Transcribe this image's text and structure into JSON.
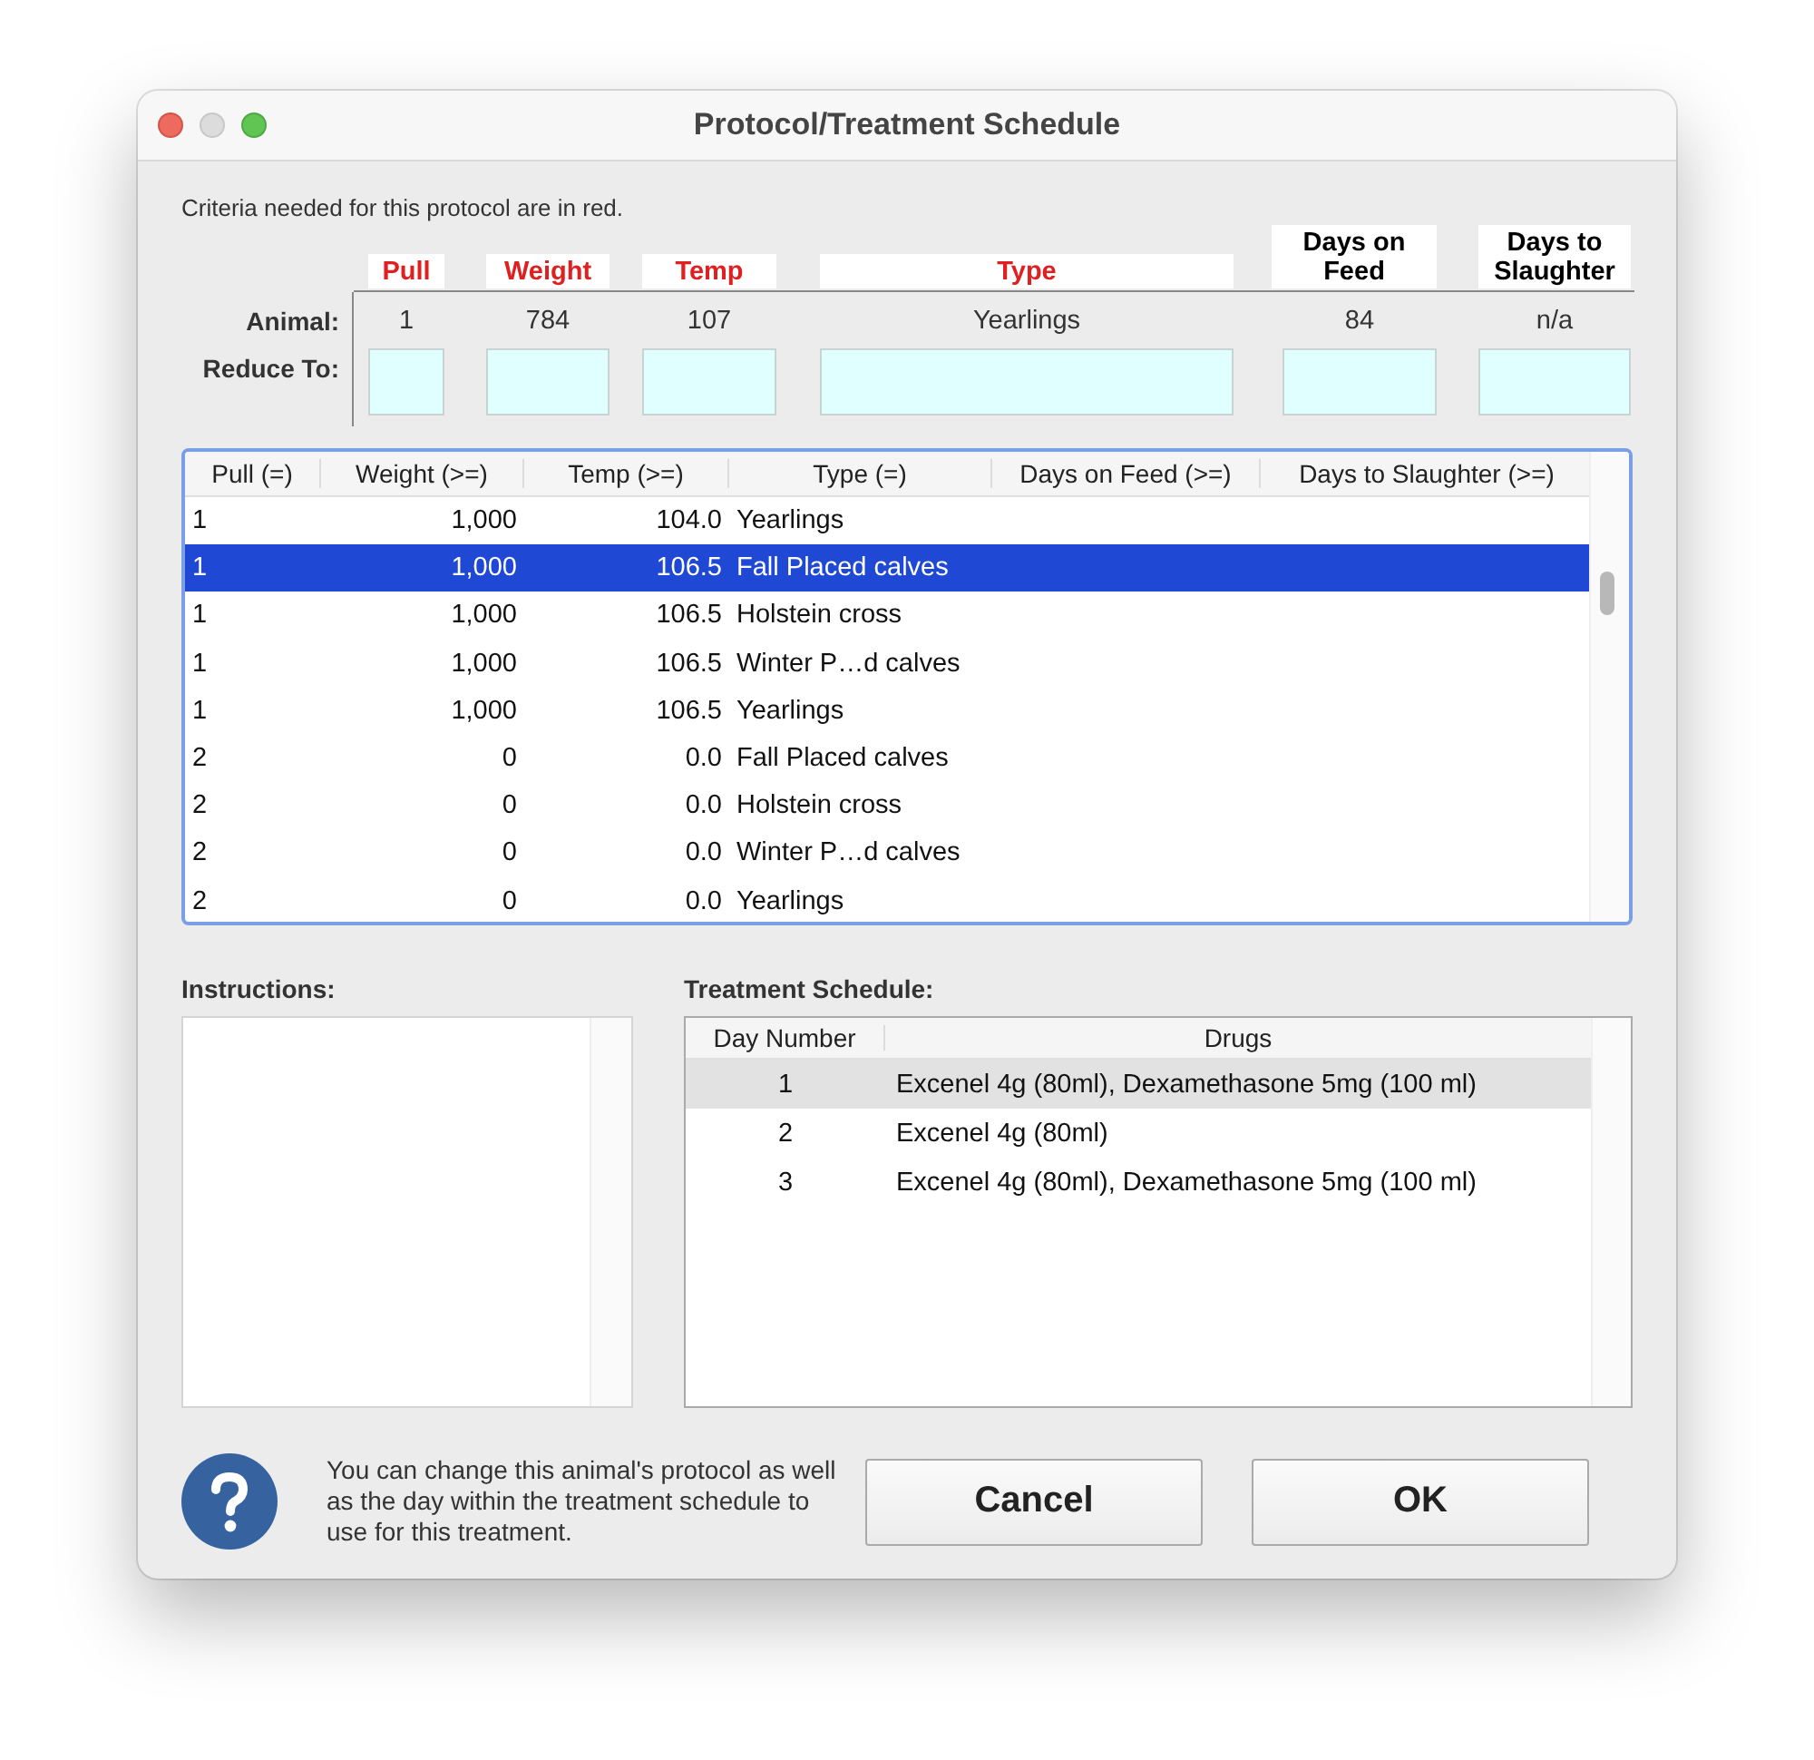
{
  "window": {
    "title": "Protocol/Treatment Schedule",
    "controls": [
      {
        "kind": "close",
        "disabled": false
      },
      {
        "kind": "minimize",
        "disabled": true
      },
      {
        "kind": "zoom",
        "disabled": false
      }
    ]
  },
  "criteria": {
    "note": "Criteria needed for this protocol are in red.",
    "columns": [
      {
        "label": "Pull",
        "required": true
      },
      {
        "label": "Weight",
        "required": true
      },
      {
        "label": "Temp",
        "required": true
      },
      {
        "label": "Type",
        "required": true
      },
      {
        "label": "Days on Feed",
        "required": false
      },
      {
        "label": "Days to Slaughter",
        "required": false
      }
    ],
    "animal": {
      "label": "Animal:",
      "values": [
        "1",
        "784",
        "107",
        "Yearlings",
        "84",
        "n/a"
      ]
    },
    "reduce_to": {
      "label": "Reduce To:"
    }
  },
  "protocol_table": {
    "columns": [
      "Pull (=)",
      "Weight (>=)",
      "Temp (>=)",
      "Type (=)",
      "Days on Feed (>=)",
      "Days to Slaughter (>=)"
    ],
    "rows": [
      {
        "cells": [
          "1",
          "1,000",
          "104.0",
          "Yearlings"
        ],
        "selected": false
      },
      {
        "cells": [
          "1",
          "1,000",
          "106.5",
          "Fall Placed calves"
        ],
        "selected": true
      },
      {
        "cells": [
          "1",
          "1,000",
          "106.5",
          "Holstein cross"
        ],
        "selected": false
      },
      {
        "cells": [
          "1",
          "1,000",
          "106.5",
          "Winter P…d calves"
        ],
        "selected": false
      },
      {
        "cells": [
          "1",
          "1,000",
          "106.5",
          "Yearlings"
        ],
        "selected": false
      },
      {
        "cells": [
          "2",
          "0",
          "0.0",
          "Fall Placed calves"
        ],
        "selected": false
      },
      {
        "cells": [
          "2",
          "0",
          "0.0",
          "Holstein cross"
        ],
        "selected": false
      },
      {
        "cells": [
          "2",
          "0",
          "0.0",
          "Winter P…d calves"
        ],
        "selected": false
      },
      {
        "cells": [
          "2",
          "0",
          "0.0",
          "Yearlings"
        ],
        "selected": false
      }
    ]
  },
  "instructions": {
    "label": "Instructions:"
  },
  "treatment_schedule": {
    "label": "Treatment Schedule:",
    "columns": [
      "Day Number",
      "Drugs"
    ],
    "rows": [
      {
        "cells": [
          "1",
          "Excenel 4g (80ml), Dexamethasone 5mg (100 ml)"
        ],
        "selected": true
      },
      {
        "cells": [
          "2",
          "Excenel 4g (80ml)"
        ],
        "selected": false
      },
      {
        "cells": [
          "3",
          "Excenel 4g (80ml), Dexamethasone 5mg (100 ml)"
        ],
        "selected": false
      }
    ]
  },
  "help_text": "You can change this animal's protocol as well as the day within the treatment schedule to use for this treatment.",
  "buttons": [
    {
      "label": "Cancel"
    },
    {
      "label": "OK"
    }
  ]
}
